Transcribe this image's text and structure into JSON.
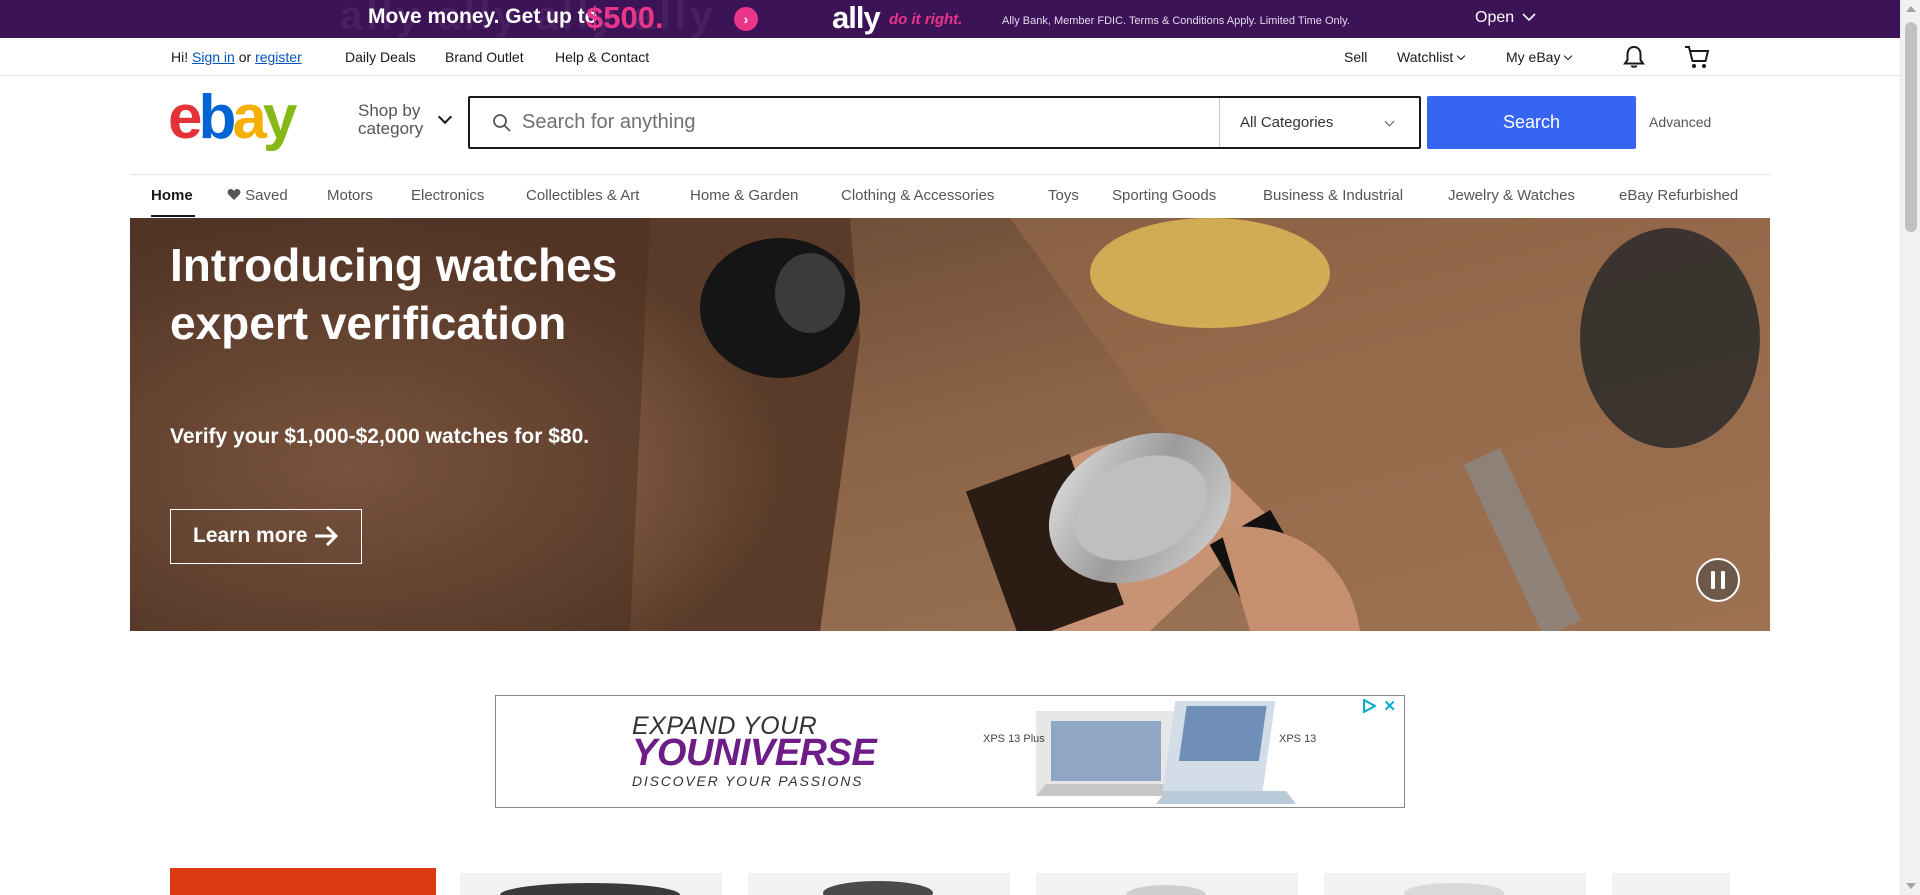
{
  "ad_banner": {
    "bg_text": "ally ally ally ally",
    "headline": "Move money. Get up to",
    "amount": "$500.",
    "logo": "ally",
    "tagline": "do it right.",
    "legal": "Ally Bank, Member FDIC. Terms & Conditions Apply. Limited Time Only.",
    "open_label": "Open",
    "colors": {
      "background": "#3d1357",
      "accent": "#e9358a"
    }
  },
  "utility_nav": {
    "greeting": "Hi!",
    "sign_in": "Sign in",
    "or": "or",
    "register": "register",
    "daily_deals": "Daily Deals",
    "brand_outlet": "Brand Outlet",
    "help_contact": "Help & Contact",
    "sell": "Sell",
    "watchlist": "Watchlist",
    "my_ebay": "My eBay"
  },
  "header": {
    "logo": {
      "e": "e",
      "b": "b",
      "a": "a",
      "y": "y"
    },
    "shop_by_line1": "Shop by",
    "shop_by_line2": "category",
    "search_placeholder": "Search for anything",
    "category_selected": "All Categories",
    "search_button": "Search",
    "advanced": "Advanced",
    "colors": {
      "search_button": "#3665f3",
      "logo_e": "#e53238",
      "logo_b": "#0064d2",
      "logo_a": "#f5af02",
      "logo_y": "#86b817"
    }
  },
  "category_nav": {
    "items": [
      "Home",
      "Saved",
      "Motors",
      "Electronics",
      "Collectibles & Art",
      "Home & Garden",
      "Clothing & Accessories",
      "Toys",
      "Sporting Goods",
      "Business & Industrial",
      "Jewelry & Watches",
      "eBay Refurbished"
    ],
    "active": "Home"
  },
  "hero": {
    "title": "Introducing watches expert verification",
    "subtitle": "Verify your $1,000-$2,000 watches for $80.",
    "cta": "Learn more"
  },
  "sponsored_ad": {
    "line1": "EXPAND YOUR",
    "line2": "YOUNIVERSE",
    "line3": "DISCOVER YOUR PASSIONS",
    "product_left": "XPS 13 Plus",
    "product_right": "XPS 13",
    "close_label": "✕"
  }
}
